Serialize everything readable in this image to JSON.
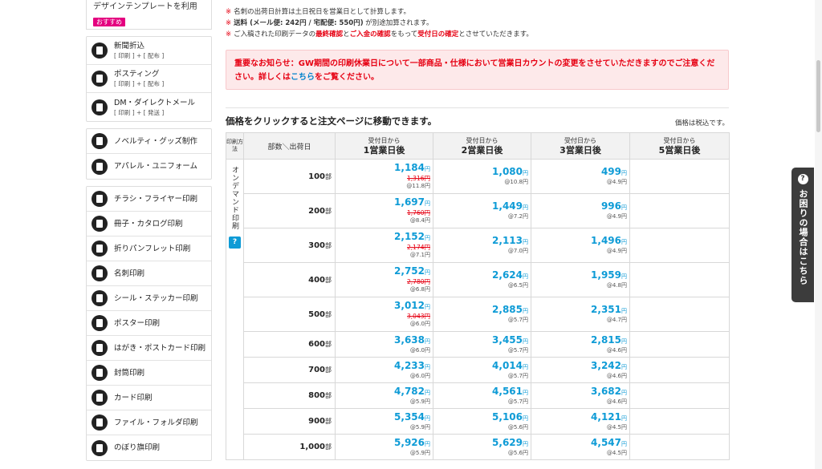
{
  "sidebar": {
    "top": {
      "label": "デザインテンプレートを利用",
      "badge": "おすすめ"
    },
    "group1": [
      {
        "label": "新聞折込",
        "sub": "[ 印刷 ] + [ 配布 ]",
        "icon": "newspaper-icon"
      },
      {
        "label": "ポスティング",
        "sub": "[ 印刷 ] + [ 配布 ]",
        "icon": "mailbox-icon"
      },
      {
        "label": "DM・ダイレクトメール",
        "sub": "[ 印刷 ] + [ 発送 ]",
        "icon": "mail-icon"
      }
    ],
    "group2": [
      {
        "label": "ノベルティ・グッズ制作",
        "icon": "gift-icon"
      },
      {
        "label": "アパレル・ユニフォーム",
        "icon": "tshirt-icon"
      }
    ],
    "group3": [
      {
        "label": "チラシ・フライヤー印刷",
        "icon": "flyer-icon"
      },
      {
        "label": "冊子・カタログ印刷",
        "icon": "book-icon"
      },
      {
        "label": "折りパンフレット印刷",
        "icon": "pamphlet-icon"
      },
      {
        "label": "名刺印刷",
        "icon": "business-card-icon"
      },
      {
        "label": "シール・ステッカー印刷",
        "icon": "sticker-icon"
      },
      {
        "label": "ポスター印刷",
        "icon": "poster-icon"
      },
      {
        "label": "はがき・ポストカード印刷",
        "icon": "postcard-icon"
      },
      {
        "label": "封筒印刷",
        "icon": "envelope-icon"
      },
      {
        "label": "カード印刷",
        "icon": "card-icon"
      },
      {
        "label": "ファイル・フォルダ印刷",
        "icon": "folder-icon"
      },
      {
        "label": "のぼり旗印刷",
        "icon": "flag-icon"
      }
    ]
  },
  "notes": {
    "mark": "※",
    "n1": "名刺の出荷日計算は土日祝日を営業日として計算します。",
    "n2_bold": "送料 (メール便: 242円 / 宅配便: 550円)",
    "n2_rest": " が別途加算されます。",
    "n3_a": "ご入稿された印刷データの",
    "n3_red1": "最終確認",
    "n3_b": "と",
    "n3_red2": "ご入金の確認",
    "n3_c": "をもって",
    "n3_red3": "受付日の確定",
    "n3_d": "とさせていただきます。"
  },
  "alert": {
    "text_a": "重要なお知らせ：GW期間の印刷休業日について一部商品・仕様において営業日カウントの変更をさせていただきますのでご注意ください。詳しくは",
    "link": "こちら",
    "text_b": "をご覧ください。"
  },
  "table": {
    "title": "価格をクリックすると注文ページに移動できます。",
    "tax_note": "価格は税込です。",
    "header_method": "印刷方法",
    "header_qty": "部数＼出荷日",
    "days": [
      {
        "top": "受付日から",
        "main": "1営業日後"
      },
      {
        "top": "受付日から",
        "main": "2営業日後"
      },
      {
        "top": "受付日から",
        "main": "3営業日後"
      },
      {
        "top": "受付日から",
        "main": "5営業日後"
      }
    ],
    "method": "オンデマンド印刷",
    "help": "?",
    "unit": "部",
    "yen": "円",
    "rows": [
      {
        "qty": "100",
        "d1": {
          "price": "1,184",
          "old": "1,316円",
          "per": "@11.8円"
        },
        "d2": {
          "price": "1,080",
          "per": "@10.8円"
        },
        "d3": {
          "price": "499",
          "per": "@4.9円"
        }
      },
      {
        "qty": "200",
        "d1": {
          "price": "1,697",
          "old": "1,760円",
          "per": "@8.4円"
        },
        "d2": {
          "price": "1,449",
          "per": "@7.2円"
        },
        "d3": {
          "price": "996",
          "per": "@4.9円"
        }
      },
      {
        "qty": "300",
        "d1": {
          "price": "2,152",
          "old": "2,174円",
          "per": "@7.1円"
        },
        "d2": {
          "price": "2,113",
          "per": "@7.0円"
        },
        "d3": {
          "price": "1,496",
          "per": "@4.9円"
        }
      },
      {
        "qty": "400",
        "d1": {
          "price": "2,752",
          "old": "2,780円",
          "per": "@6.8円"
        },
        "d2": {
          "price": "2,624",
          "per": "@6.5円"
        },
        "d3": {
          "price": "1,959",
          "per": "@4.8円"
        }
      },
      {
        "qty": "500",
        "d1": {
          "price": "3,012",
          "old": "3,043円",
          "per": "@6.0円"
        },
        "d2": {
          "price": "2,885",
          "per": "@5.7円"
        },
        "d3": {
          "price": "2,351",
          "per": "@4.7円"
        }
      },
      {
        "qty": "600",
        "d1": {
          "price": "3,638",
          "per": "@6.0円"
        },
        "d2": {
          "price": "3,455",
          "per": "@5.7円"
        },
        "d3": {
          "price": "2,815",
          "per": "@4.6円"
        }
      },
      {
        "qty": "700",
        "d1": {
          "price": "4,233",
          "per": "@6.0円"
        },
        "d2": {
          "price": "4,014",
          "per": "@5.7円"
        },
        "d3": {
          "price": "3,242",
          "per": "@4.6円"
        }
      },
      {
        "qty": "800",
        "d1": {
          "price": "4,782",
          "per": "@5.9円"
        },
        "d2": {
          "price": "4,561",
          "per": "@5.7円"
        },
        "d3": {
          "price": "3,682",
          "per": "@4.6円"
        }
      },
      {
        "qty": "900",
        "d1": {
          "price": "5,354",
          "per": "@5.9円"
        },
        "d2": {
          "price": "5,106",
          "per": "@5.6円"
        },
        "d3": {
          "price": "4,121",
          "per": "@4.5円"
        }
      },
      {
        "qty": "1,000",
        "d1": {
          "price": "5,926",
          "per": "@5.9円"
        },
        "d2": {
          "price": "5,629",
          "per": "@5.6円"
        },
        "d3": {
          "price": "4,547",
          "per": "@4.5円"
        }
      }
    ]
  },
  "help_tab": {
    "q": "?",
    "text": "お困りの場合はこちら"
  },
  "colors": {
    "accent_blue": "#0e9bd6",
    "alert_red": "#e60012",
    "badge_pink": "#e4007f"
  }
}
